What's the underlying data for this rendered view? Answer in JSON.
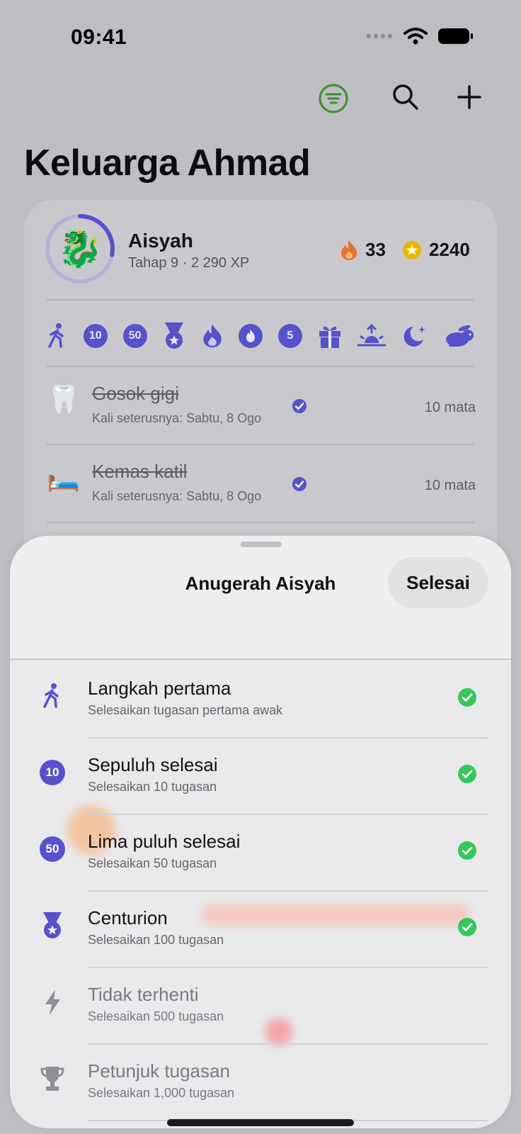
{
  "status_bar": {
    "time": "09:41"
  },
  "header": {
    "title": "Keluarga Ahmad"
  },
  "member": {
    "name": "Aisyah",
    "meta": "Tahap 9 · 2 290 XP",
    "avatar": "🐉",
    "level_progress": 0.28,
    "streak": "33",
    "coins": "2240"
  },
  "badges": [
    "walk-icon",
    "10",
    "50",
    "medal-icon",
    "flame-icon",
    "flame-circle-icon",
    "5",
    "gift-icon",
    "sunrise-icon",
    "moon-icon",
    "rabbit-icon"
  ],
  "tasks": [
    {
      "emoji": "🦷",
      "title": "Gosok gigi",
      "subtitle": "Kali seterusnya: Sabtu, 8 Ogo",
      "points": "10 mata"
    },
    {
      "emoji": "🛏️",
      "title": "Kemas katil",
      "subtitle": "Kali seterusnya: Sabtu, 8 Ogo",
      "points": "10 mata"
    }
  ],
  "sheet": {
    "title": "Anugerah Aisyah",
    "done_label": "Selesai",
    "achievements": [
      {
        "title": "Langkah pertama",
        "description": "Selesaikan tugasan pertama awak",
        "icon": "walk-icon",
        "earned": true
      },
      {
        "title": "Sepuluh selesai",
        "description": "Selesaikan 10 tugasan",
        "icon": "10",
        "earned": true
      },
      {
        "title": "Lima puluh selesai",
        "description": "Selesaikan 50 tugasan",
        "icon": "50",
        "earned": true
      },
      {
        "title": "Centurion",
        "description": "Selesaikan 100 tugasan",
        "icon": "medal-icon",
        "earned": true
      },
      {
        "title": "Tidak terhenti",
        "description": "Selesaikan 500 tugasan",
        "icon": "bolt-icon",
        "earned": false
      },
      {
        "title": "Petunjuk tugasan",
        "description": "Selesaikan 1,000 tugasan",
        "icon": "trophy-icon",
        "earned": false
      }
    ]
  },
  "colors": {
    "accent": "#5552cc",
    "success": "#34c759",
    "filter_green": "#3e8e2e",
    "streak": "#e8732a",
    "coin": "#e6b800"
  }
}
